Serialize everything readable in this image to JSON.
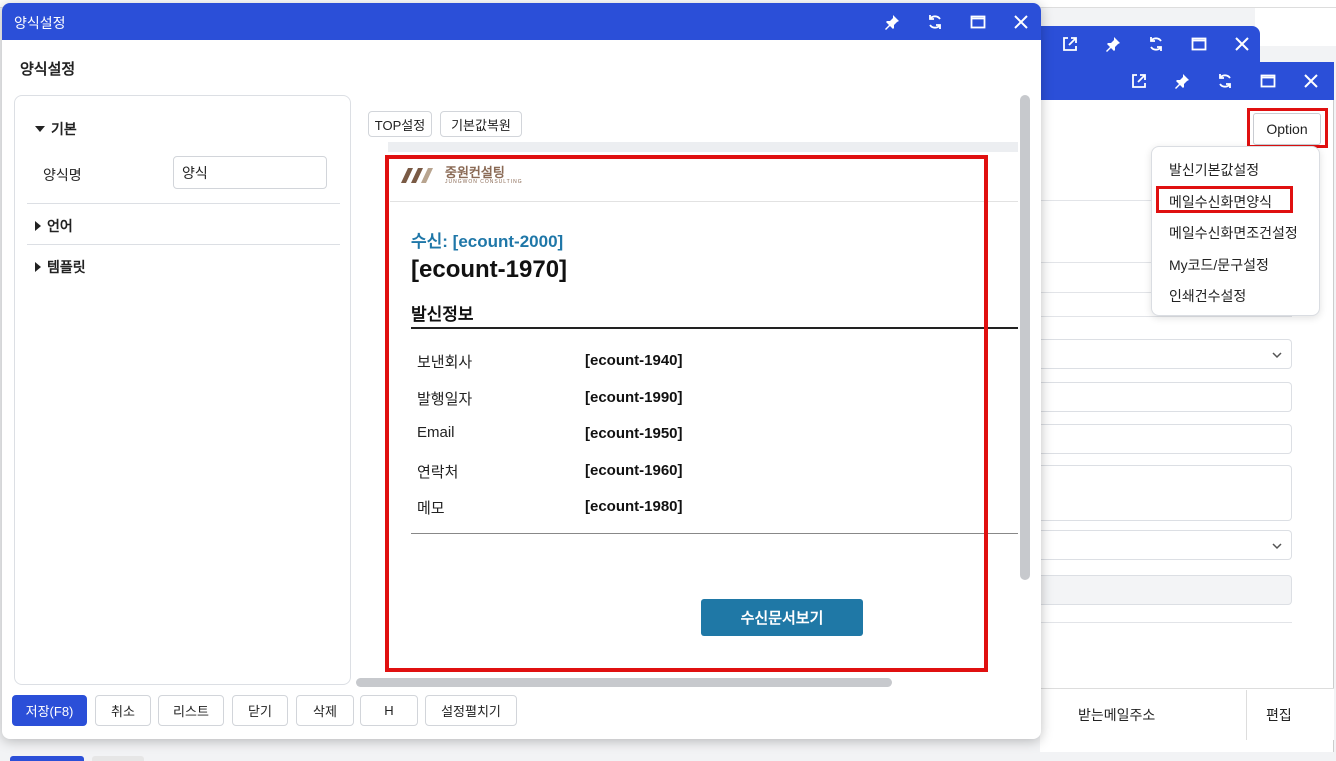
{
  "main_window": {
    "title": "양식설정",
    "page_title": "양식설정"
  },
  "left_panel": {
    "sections": [
      {
        "label": "기본",
        "expanded": true
      },
      {
        "label": "언어",
        "expanded": false
      },
      {
        "label": "템플릿",
        "expanded": false
      }
    ],
    "form_name_label": "양식명",
    "form_name_value": "양식"
  },
  "toolbar": {
    "top_setting": "TOP설정",
    "restore_default": "기본값복원"
  },
  "preview": {
    "logo_text": "중원컨설팅",
    "logo_sub": "JUNGWON CONSULTING",
    "to_line": "수신: [ecount-2000]",
    "heading": "[ecount-1970]",
    "section_title": "발신정보",
    "rows": [
      {
        "label": "보낸회사",
        "value": "[ecount-1940]"
      },
      {
        "label": "발행일자",
        "value": "[ecount-1990]"
      },
      {
        "label": "Email",
        "value": "[ecount-1950]"
      },
      {
        "label": "연락처",
        "value": "[ecount-1960]"
      },
      {
        "label": "메모",
        "value": "[ecount-1980]"
      }
    ],
    "view_button": "수신문서보기"
  },
  "footer": {
    "save": "저장(F8)",
    "cancel": "취소",
    "list": "리스트",
    "close": "닫기",
    "delete": "삭제",
    "h": "H",
    "expand_settings": "설정펼치기"
  },
  "background_window": {
    "option_button": "Option",
    "dropdown_items": [
      "발신기본값설정",
      "메일수신화면양식",
      "메일수신화면조건설정",
      "My코드/문구설정",
      "인쇄건수설정"
    ],
    "grid_headers": [
      "받는메일주소",
      "편집"
    ]
  },
  "colors": {
    "titlebar": "#2b4fd8",
    "highlight": "#e01010",
    "preview_accent": "#1f77a8",
    "logo": "#8a6a55"
  }
}
